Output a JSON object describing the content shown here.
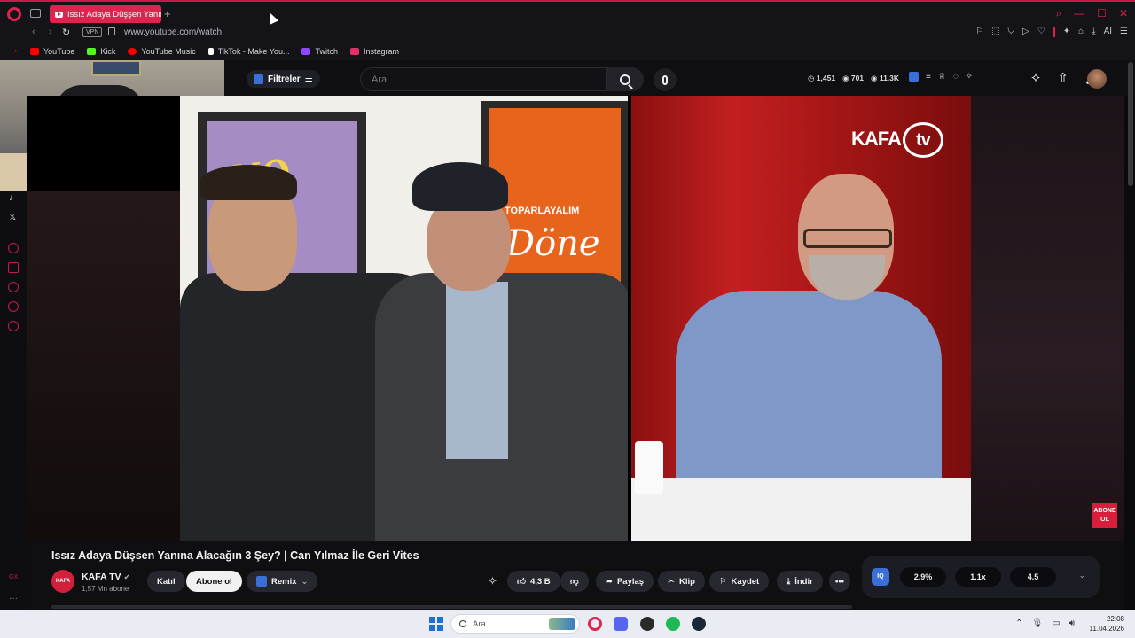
{
  "browser": {
    "tab_title": "Issız Adaya Düşşen Yanına",
    "url": "www.youtube.com/watch",
    "vpn_label": "VPN",
    "ai_label": "AI",
    "accent_color": "#e0234e"
  },
  "bookmarks": [
    {
      "label": "YouTube",
      "icon": "youtube-icon",
      "color": "#ff0000"
    },
    {
      "label": "Kick",
      "icon": "kick-icon",
      "color": "#53fc18"
    },
    {
      "label": "YouTube Music",
      "icon": "youtube-music-icon",
      "color": "#ff0000"
    },
    {
      "label": "TikTok - Make You...",
      "icon": "tiktok-icon",
      "color": "#ffffff"
    },
    {
      "label": "Twitch",
      "icon": "twitch-icon",
      "color": "#9146ff"
    },
    {
      "label": "Instagram",
      "icon": "instagram-icon",
      "color": "#e1306c"
    }
  ],
  "youtube": {
    "filters_label": "Filtreler",
    "search_placeholder": "Ara",
    "stats": {
      "a": "1,451",
      "b": "701",
      "c": "11.3K"
    },
    "video": {
      "overlay_logo": "KAFA",
      "overlay_logo_tv": "tv",
      "poster_text_1": "NO",
      "poster_text_2": "Döne",
      "poster_text_3": "TOPARLAYALIM",
      "subscribe_badge": "ABONE OL"
    },
    "title": "Issız Adaya Düşsen Yanına Alacağın 3 Şey? | Can Yılmaz İle Geri Vites",
    "channel": {
      "name": "KAFA TV",
      "subscribers": "1,57 Mn abone",
      "avatar_text": "KAFA"
    },
    "buttons": {
      "join": "Katıl",
      "subscribe": "Abone ol",
      "remix": "Remix",
      "likes": "4,3 B",
      "share": "Paylaş",
      "clip": "Klip",
      "save": "Kaydet",
      "download": "İndir",
      "more": "•••"
    },
    "iq_panel": {
      "badge": "IQ",
      "values": [
        "2.9%",
        "1.1x",
        "4.5"
      ]
    }
  },
  "taskbar": {
    "search_placeholder": "Ara",
    "time": "22:08",
    "date": "11.04.2026"
  }
}
